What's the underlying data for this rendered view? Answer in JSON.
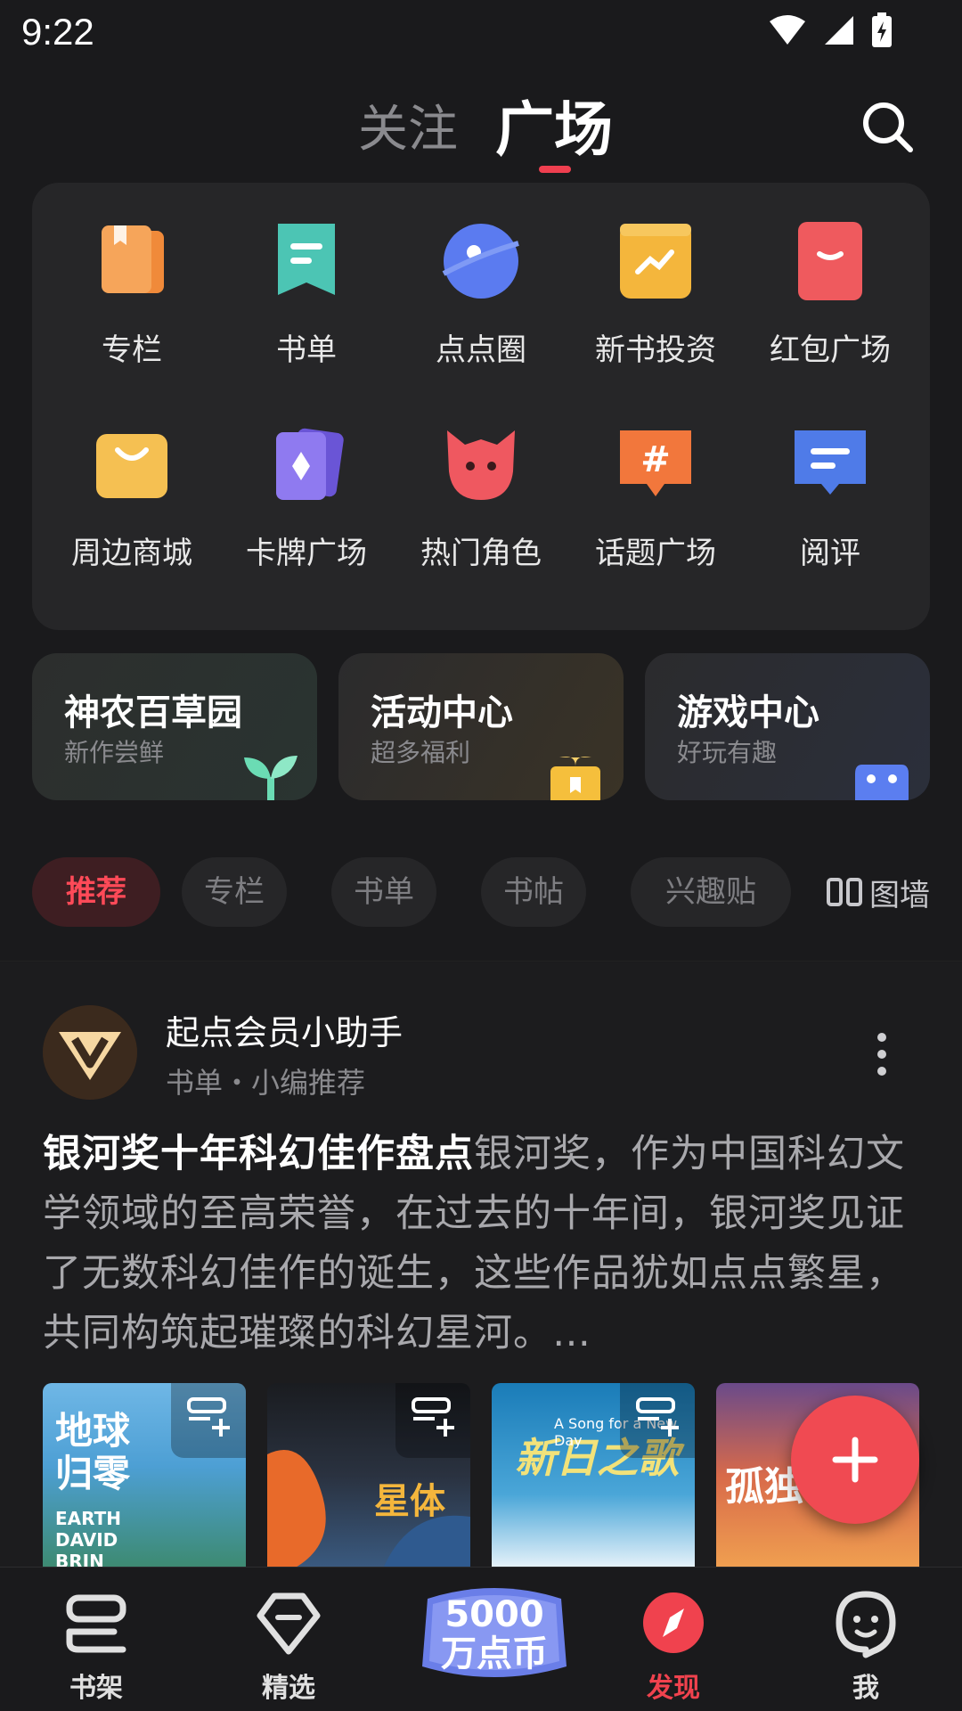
{
  "status_bar": {
    "time": "9:22"
  },
  "top_tabs": {
    "follow": "关注",
    "plaza": "广场"
  },
  "grid": [
    {
      "label": "专栏",
      "icon": "column-icon"
    },
    {
      "label": "书单",
      "icon": "booklist-icon"
    },
    {
      "label": "点点圈",
      "icon": "planet-icon"
    },
    {
      "label": "新书投资",
      "icon": "invest-icon"
    },
    {
      "label": "红包广场",
      "icon": "red-envelope-icon"
    },
    {
      "label": "周边商城",
      "icon": "shopping-bag-icon"
    },
    {
      "label": "卡牌广场",
      "icon": "card-icon"
    },
    {
      "label": "热门角色",
      "icon": "character-icon"
    },
    {
      "label": "话题广场",
      "icon": "topic-icon"
    },
    {
      "label": "阅评",
      "icon": "review-icon"
    }
  ],
  "features": [
    {
      "title": "神农百草园",
      "subtitle": "新作尝鲜"
    },
    {
      "title": "活动中心",
      "subtitle": "超多福利"
    },
    {
      "title": "游戏中心",
      "subtitle": "好玩有趣"
    }
  ],
  "filters": {
    "chips": [
      "推荐",
      "专栏",
      "书单",
      "书帖",
      "兴趣贴"
    ],
    "active": "推荐",
    "wall": "图墙"
  },
  "post": {
    "author": "起点会员小助手",
    "meta": "书单・小编推荐",
    "highlight": "银河奖十年科幻佳作盘点",
    "body": "银河奖，作为中国科幻文学领域的至高荣誉，在过去的十年间，银河奖见证了无数科幻佳作的诞生，这些作品犹如点点繁星，共同构筑起璀璨的科幻星河。…",
    "covers": [
      {
        "title": "地球归零",
        "sub": "EARTH DAVID BRIN"
      },
      {
        "title": "星体"
      },
      {
        "title": "新日之歌",
        "sub": "A Song for a New Day"
      },
      {
        "title": "孤独"
      }
    ]
  },
  "bottom_nav": {
    "items": [
      {
        "label": "书架",
        "icon": "bookshelf-icon"
      },
      {
        "label": "精选",
        "icon": "diamond-icon"
      },
      {
        "label": "发现",
        "icon": "compass-icon"
      },
      {
        "label": "我",
        "icon": "profile-icon"
      }
    ],
    "promo": "5000万点币",
    "active": "发现"
  },
  "colors": {
    "accent": "#f0424e",
    "background": "#1a1a1c",
    "card": "#262628"
  }
}
